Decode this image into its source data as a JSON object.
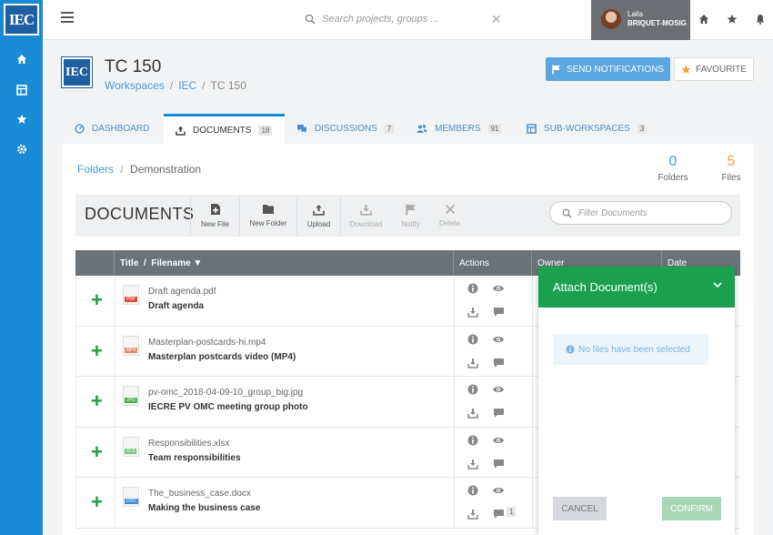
{
  "app": {
    "logo_text": "IEC"
  },
  "search": {
    "placeholder": "Search projects, groups ..."
  },
  "user": {
    "first_name": "Laila",
    "last_name": "BRIQUET-MOSIG"
  },
  "workspace": {
    "title": "TC 150",
    "breadcrumb": [
      "Workspaces",
      "IEC",
      "TC 150"
    ],
    "send_notifications_label": "SEND NOTIFICATIONS",
    "favourite_label": "FAVOURITE"
  },
  "tabs": [
    {
      "label": "DASHBOARD",
      "icon": "dashboard-icon",
      "count": ""
    },
    {
      "label": "DOCUMENTS",
      "icon": "upload-icon",
      "count": "18"
    },
    {
      "label": "DISCUSSIONS",
      "icon": "chat-icon",
      "count": "7"
    },
    {
      "label": "MEMBERS",
      "icon": "users-icon",
      "count": "91"
    },
    {
      "label": "SUB-WORKSPACES",
      "icon": "layers-icon",
      "count": "3"
    }
  ],
  "folder_nav": {
    "root": "Folders",
    "current": "Demonstration"
  },
  "stats": {
    "folders": {
      "value": "0",
      "label": "Folders",
      "color": "#4a9bd6"
    },
    "files": {
      "value": "5",
      "label": "Files",
      "color": "#f0a050"
    }
  },
  "toolbar": {
    "title": "DOCUMENTS",
    "new_file": "New File",
    "new_folder": "New Folder",
    "upload": "Upload",
    "download": "Download",
    "notify": "Notify",
    "delete": "Delete",
    "filter_placeholder": "Filter Documents"
  },
  "table": {
    "headers": {
      "title": "Title",
      "sep": "/",
      "filename": "Filename ▼",
      "actions": "Actions",
      "owner": "Owner",
      "date": "Date"
    },
    "rows": [
      {
        "filename": "Draft agenda.pdf",
        "title": "Draft agenda",
        "type": "PDF",
        "type_color": "#e04b3a",
        "comment_count": ""
      },
      {
        "filename": "Masterplan-postcards-hi.mp4",
        "title": "Masterplan postcards video (MP4)",
        "type": "MP4",
        "type_color": "#e8876b",
        "comment_count": ""
      },
      {
        "filename": "pv-omc_2018-04-09-10_group_big.jpg",
        "title": "IECRE PV OMC meeting group photo",
        "type": "JPG",
        "type_color": "#4caf50",
        "comment_count": ""
      },
      {
        "filename": "Responsibilities.xlsx",
        "title": "Team responsibilities",
        "type": "XLS",
        "type_color": "#7cc38a",
        "comment_count": ""
      },
      {
        "filename": "The_business_case.docx",
        "title": "Making the business case",
        "type": "DOC",
        "type_color": "#3d8fd4",
        "comment_count": "1"
      }
    ]
  },
  "attach_popup": {
    "title": "Attach Document(s)",
    "empty_message": "No files have been selected",
    "cancel": "CANCEL",
    "confirm": "CONFIRM"
  }
}
